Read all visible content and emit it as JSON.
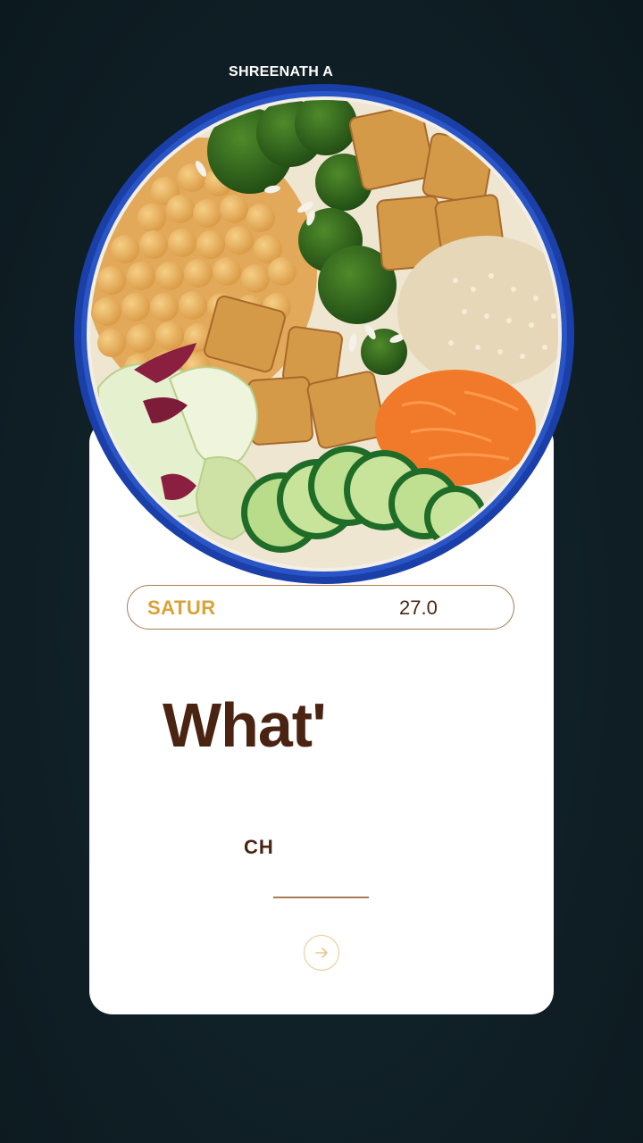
{
  "author": "SHREENATH A",
  "pill": {
    "day": "SATUR",
    "value": "27.0"
  },
  "headline": "What'",
  "subheading": "CH",
  "icons": {
    "next": "arrow-right-icon",
    "image": "food-bowl-image"
  },
  "colors": {
    "background": "#10212a",
    "card": "#ffffff",
    "accent_gold": "#d9a237",
    "text_brown": "#4a2312",
    "border_brown": "#a77a55",
    "bowl_rim": "#1b3fa8"
  }
}
